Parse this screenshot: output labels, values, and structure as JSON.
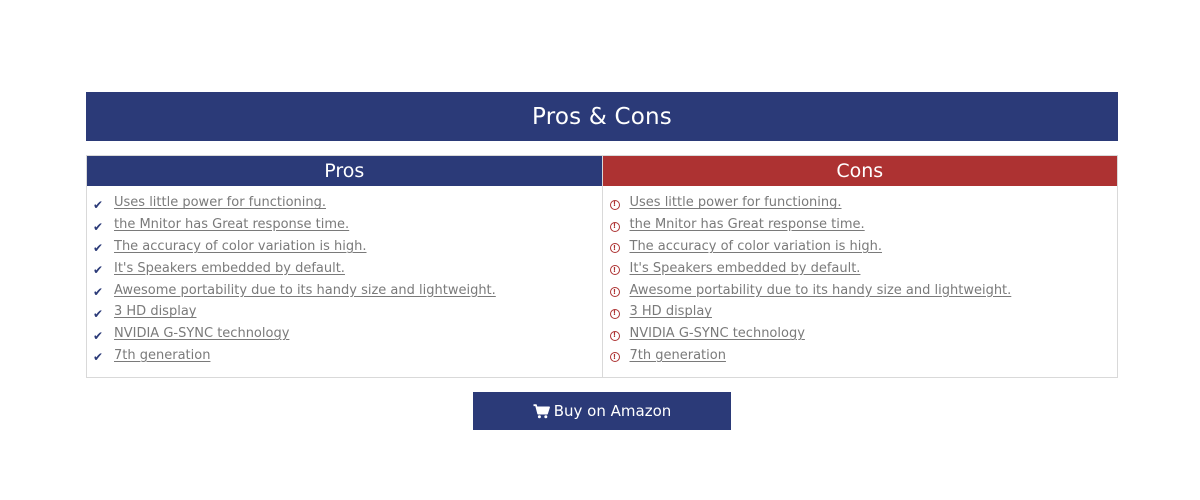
{
  "banner": {
    "title": "Pros & Cons"
  },
  "pros": {
    "heading": "Pros",
    "icon": "check-icon",
    "color": "#2b3a78",
    "items": [
      "Uses little power for functioning.",
      "the Mnitor has Great response time.",
      "The accuracy of color variation is high.",
      "It's Speakers embedded by default.",
      "Awesome portability due to its handy size and lightweight.",
      "3 HD display",
      "NVIDIA G-SYNC technology",
      "7th generation"
    ]
  },
  "cons": {
    "heading": "Cons",
    "icon": "warning-circle-icon",
    "color": "#ad3232",
    "items": [
      "Uses little power for functioning.",
      "the Mnitor has Great response time.",
      "The accuracy of color variation is high.",
      "It's Speakers embedded by default.",
      "Awesome portability due to its handy size and lightweight.",
      "3 HD display",
      "NVIDIA G-SYNC technology",
      "7th generation"
    ]
  },
  "buy_button": {
    "label": "Buy on Amazon",
    "icon": "cart-icon"
  }
}
